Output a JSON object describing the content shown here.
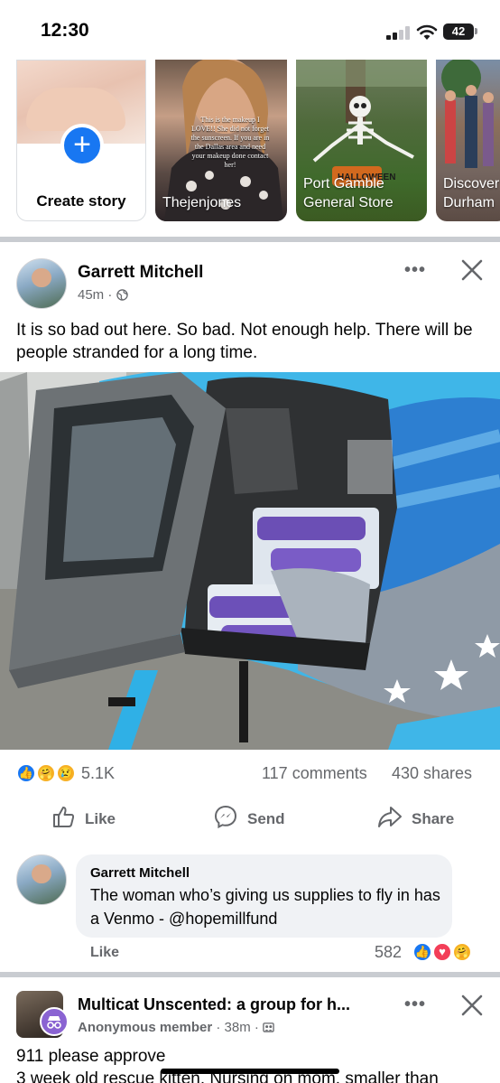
{
  "status_bar": {
    "time": "12:30",
    "battery": "42"
  },
  "stories": {
    "create_label": "Create story",
    "items": [
      {
        "name": "Thejenjones",
        "overlay_text": "This is the makeup I LOVE!! She did not forget the sunscreen. If you are in the Dallas area and need your makeup done contact her!"
      },
      {
        "name": "Port Gamble General Store"
      },
      {
        "name": "Discover Durham"
      }
    ]
  },
  "post": {
    "author": "Garrett Mitchell",
    "time": "45m",
    "text": "It is so bad out here. So bad. Not enough help. There will be people stranded for a long time.",
    "reaction_count": "5.1K",
    "comments": "117 comments",
    "shares": "430 shares",
    "actions": {
      "like": "Like",
      "send": "Send",
      "share": "Share"
    }
  },
  "comment": {
    "author": "Garrett Mitchell",
    "text": "The woman who’s giving us supplies to fly in has a Venmo - @hopemillfund",
    "like": "Like",
    "reaction_count": "582"
  },
  "group_post": {
    "name": "Multicat Unscented: a group for h...",
    "member": "Anonymous member",
    "time": "38m",
    "text": "911 please approve\n3 week old rescue kitten. Nursing on mom, smaller than"
  },
  "colors": {
    "accent": "#1877f2",
    "secondary_text": "#65676b",
    "divider": "#c9ccd1"
  },
  "icons": [
    "signal-icon",
    "wifi-icon",
    "battery-icon",
    "plus-icon",
    "globe-icon",
    "more-icon",
    "close-icon",
    "like-icon",
    "messenger-icon",
    "share-icon",
    "like-reaction-icon",
    "love-reaction-icon",
    "care-reaction-icon",
    "sad-reaction-icon",
    "anonymous-icon",
    "group-icon"
  ]
}
